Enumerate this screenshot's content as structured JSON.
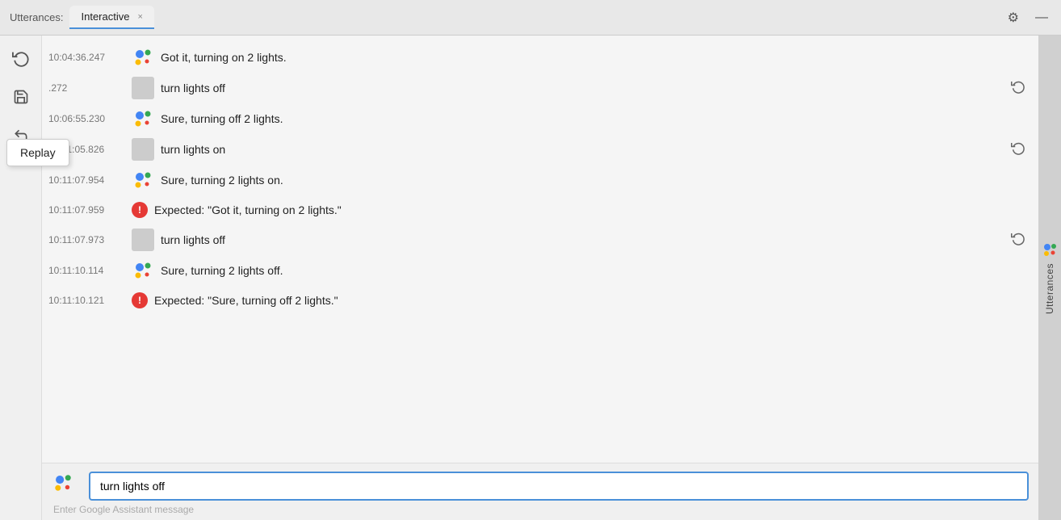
{
  "titlebar": {
    "utterances_label": "Utterances:",
    "tab_label": "Interactive",
    "tab_close": "×",
    "gear_icon": "⚙",
    "minimize_icon": "—"
  },
  "sidebar": {
    "replay_icon": "↺",
    "save_icon": "💾",
    "undo_icon": "↩",
    "replay_tooltip": "Replay"
  },
  "utterances": [
    {
      "timestamp": "10:04:36.247",
      "type": "assistant",
      "text": "Got it, turning on 2 lights.",
      "has_replay": false
    },
    {
      "timestamp": ".272",
      "type": "user",
      "text": "turn lights off",
      "has_replay": true
    },
    {
      "timestamp": "10:06:55.230",
      "type": "assistant",
      "text": "Sure, turning off 2 lights.",
      "has_replay": false
    },
    {
      "timestamp": "10:11:05.826",
      "type": "user",
      "text": "turn lights on",
      "has_replay": true
    },
    {
      "timestamp": "10:11:07.954",
      "type": "assistant",
      "text": "Sure, turning 2 lights on.",
      "has_replay": false
    },
    {
      "timestamp": "10:11:07.959",
      "type": "error",
      "text": "Expected: \"Got it, turning on 2 lights.\"",
      "has_replay": false
    },
    {
      "timestamp": "10:11:07.973",
      "type": "user",
      "text": "turn lights off",
      "has_replay": true
    },
    {
      "timestamp": "10:11:10.114",
      "type": "assistant",
      "text": "Sure, turning 2 lights off.",
      "has_replay": false
    },
    {
      "timestamp": "10:11:10.121",
      "type": "error",
      "text": "Expected: \"Sure, turning off 2 lights.\"",
      "has_replay": false
    }
  ],
  "input": {
    "value": "turn lights off",
    "placeholder": "Enter Google Assistant message"
  },
  "right_tab": {
    "label": "Utterances"
  }
}
